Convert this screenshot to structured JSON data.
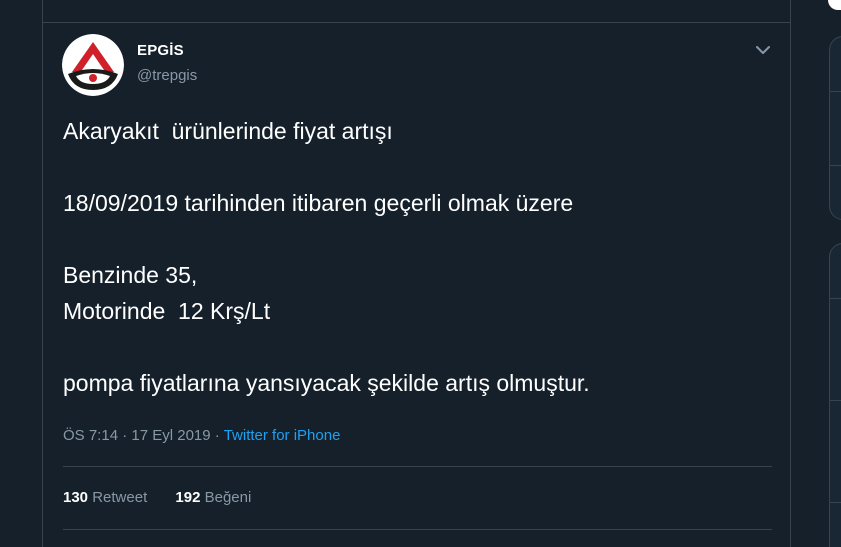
{
  "tweet": {
    "display_name": "EPGİS",
    "handle": "@trepgis",
    "avatar_icon": "epgis-logo-icon",
    "caret_icon": "chevron-down-icon",
    "text": "Akaryakıt  ürünlerinde fiyat artışı\n\n18/09/2019 tarihinden itibaren geçerli olmak üzere\n\nBenzinde 35,\nMotorinde  12 Krş/Lt\n\npompa fiyatlarına yansıyacak şekilde artış olmuştur.",
    "time": "ÖS 7:14",
    "separator": "·",
    "date": "17 Eyl 2019",
    "source": "Twitter for iPhone"
  },
  "stats": {
    "retweets_count": "130",
    "retweets_label": "Retweet",
    "likes_count": "192",
    "likes_label": "Beğeni"
  },
  "colors": {
    "background": "#15202b",
    "border": "#38444d",
    "secondary_text": "#8899a6",
    "link": "#1da1f2",
    "logo_red": "#d0202a"
  }
}
